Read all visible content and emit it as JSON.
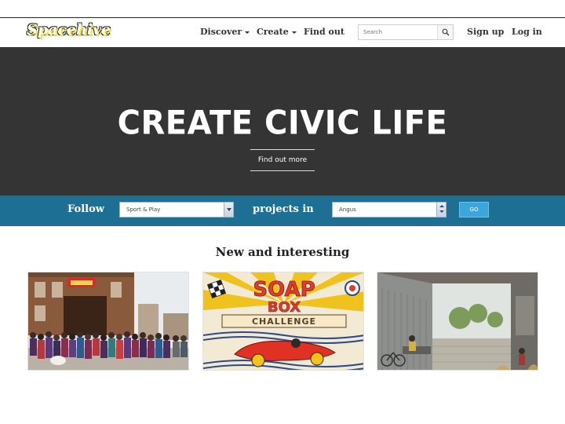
{
  "header": {
    "logo_text": "Spacehive",
    "nav": {
      "discover": "Discover",
      "create": "Create",
      "find_out": "Find out",
      "sign_up": "Sign up",
      "log_in": "Log in"
    },
    "search": {
      "placeholder": "Search"
    }
  },
  "hero": {
    "title": "CREATE CIVIC LIFE",
    "button": "Find out more"
  },
  "follow_bar": {
    "follow_label": "Follow",
    "category_select": "Sport & Play",
    "projects_in_label": "projects in",
    "location_select": "Angus",
    "go_label": "GO"
  },
  "section": {
    "title": "New and interesting",
    "cards": [
      {
        "image": "group-photo-costumes"
      },
      {
        "image": "soap-box-challenge-poster",
        "poster_text": [
          "SOAP",
          "BOX",
          "CHALLENGE"
        ]
      },
      {
        "image": "modern-building-rendering"
      }
    ]
  }
}
